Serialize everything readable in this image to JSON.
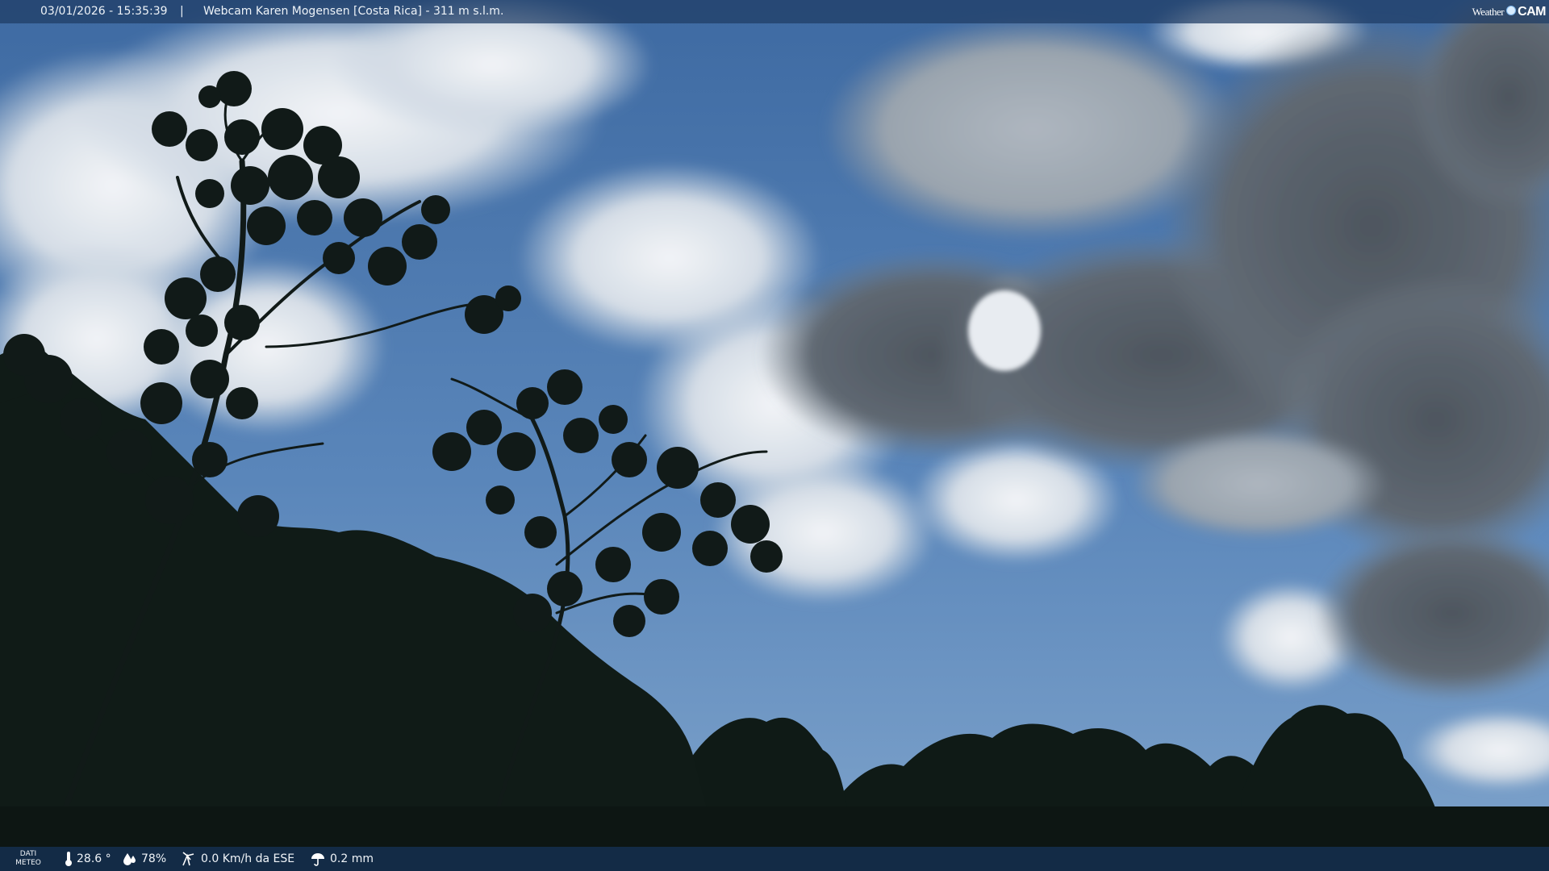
{
  "overlay": {
    "timestamp": "03/01/2026 - 15:35:39",
    "separator": "|",
    "title": "Webcam Karen Mogensen [Costa Rica] - 311 m s.l.m.",
    "brand_weather": "Weather",
    "brand_cam": "CAM"
  },
  "weather": {
    "label_line1": "DATI",
    "label_line2": "METEO",
    "temperature": "28.6 °",
    "humidity": "78%",
    "wind": "0.0 Km/h da ESE",
    "rain": "0.2 mm",
    "icons": [
      "thermometer-icon",
      "humidity-icon",
      "wind-icon",
      "rain-icon"
    ]
  },
  "colors": {
    "sky": "#4f7fb4",
    "cloud_dark": "#5d6670",
    "cloud_light": "#dde4ec",
    "vegetation": "#101a17",
    "bar": "#1e3c64"
  }
}
